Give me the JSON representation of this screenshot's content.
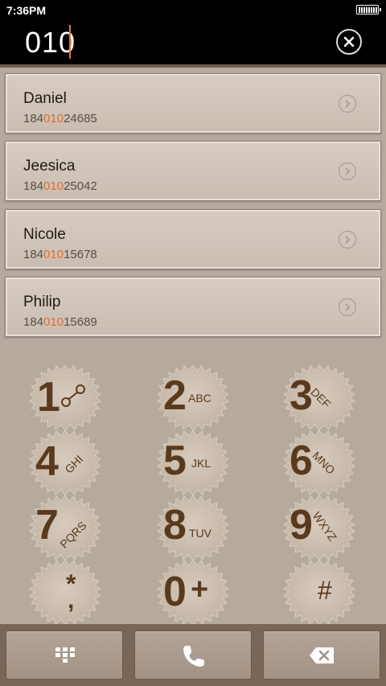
{
  "status_bar": {
    "time": "7:36PM"
  },
  "input": {
    "digits": "010"
  },
  "contacts": [
    {
      "name": "Daniel",
      "number_prefix": "184",
      "number_match": "010",
      "number_suffix": "24685"
    },
    {
      "name": "Jeesica",
      "number_prefix": "184",
      "number_match": "010",
      "number_suffix": "25042"
    },
    {
      "name": "Nicole",
      "number_prefix": "184",
      "number_match": "010",
      "number_suffix": "15678"
    },
    {
      "name": "Philip",
      "number_prefix": "184",
      "number_match": "010",
      "number_suffix": "15689"
    }
  ],
  "keypad": [
    {
      "digit": "1",
      "letters": "",
      "icon": "voicemail-icon"
    },
    {
      "digit": "2",
      "letters": "ABC"
    },
    {
      "digit": "3",
      "letters": "DEF"
    },
    {
      "digit": "4",
      "letters": "GHI"
    },
    {
      "digit": "5",
      "letters": "JKL"
    },
    {
      "digit": "6",
      "letters": "MNO"
    },
    {
      "digit": "7",
      "letters": "PQRS"
    },
    {
      "digit": "8",
      "letters": "TUV"
    },
    {
      "digit": "9",
      "letters": "WXYZ"
    },
    {
      "digit": "*",
      "letters": ","
    },
    {
      "digit": "0",
      "letters": "+"
    },
    {
      "digit": "#",
      "letters": ""
    }
  ],
  "bottom_bar": {
    "left_icon": "dialpad-toggle-icon",
    "center_icon": "phone-call-icon",
    "right_icon": "backspace-icon"
  },
  "colors": {
    "highlight": "#e36d2b",
    "key_text": "#5a3a1e",
    "background": "#b6aa9f"
  }
}
